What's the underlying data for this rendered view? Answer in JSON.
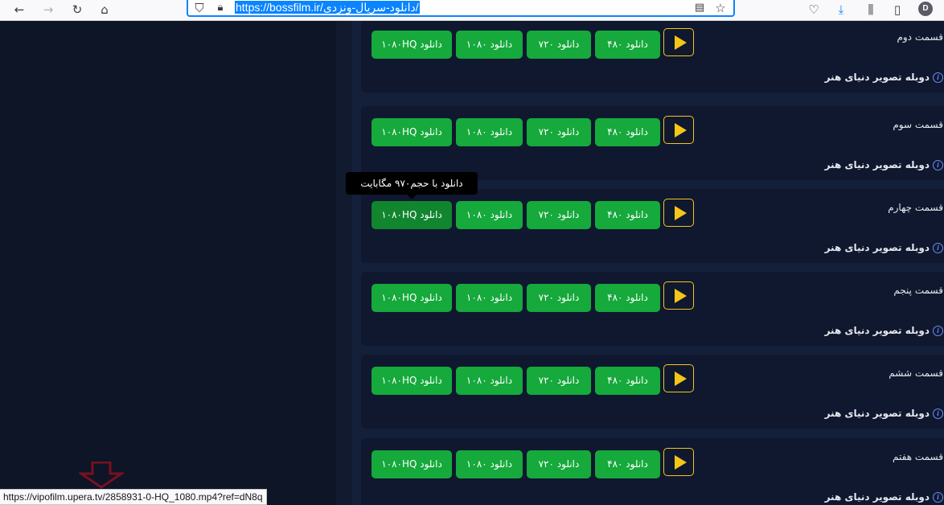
{
  "browser": {
    "url": "https://bossfilm.ir/دانلود-سریال-ونزدی/",
    "profile_initial": "D",
    "icons": [
      "back-icon",
      "forward-icon",
      "reload-icon",
      "home-icon",
      "shield-icon",
      "lock-icon",
      "reader-view-icon",
      "bookmark-star-icon",
      "pocket-icon",
      "download-icon",
      "library-icon",
      "sidebar-icon"
    ]
  },
  "episodes": [
    {
      "title": "قسمت دوم",
      "dub": "دوبله تصویر دنیای هنر",
      "b480": "دانلود ۴۸۰",
      "b720": "دانلود ۷۲۰",
      "b1080": "دانلود ۱۰۸۰",
      "bhq": "دانلود ۱۰۸۰HQ"
    },
    {
      "title": "قسمت سوم",
      "dub": "دوبله تصویر دنیای هنر",
      "b480": "دانلود ۴۸۰",
      "b720": "دانلود ۷۲۰",
      "b1080": "دانلود ۱۰۸۰",
      "bhq": "دانلود ۱۰۸۰HQ"
    },
    {
      "title": "قسمت چهارم",
      "dub": "دوبله تصویر دنیای هنر",
      "b480": "دانلود ۴۸۰",
      "b720": "دانلود ۷۲۰",
      "b1080": "دانلود ۱۰۸۰",
      "bhq": "دانلود ۱۰۸۰HQ"
    },
    {
      "title": "قسمت پنجم",
      "dub": "دوبله تصویر دنیای هنر",
      "b480": "دانلود ۴۸۰",
      "b720": "دانلود ۷۲۰",
      "b1080": "دانلود ۱۰۸۰",
      "bhq": "دانلود ۱۰۸۰HQ"
    },
    {
      "title": "قسمت ششم",
      "dub": "دوبله تصویر دنیای هنر",
      "b480": "دانلود ۴۸۰",
      "b720": "دانلود ۷۲۰",
      "b1080": "دانلود ۱۰۸۰",
      "bhq": "دانلود ۱۰۸۰HQ"
    },
    {
      "title": "قسمت هفتم",
      "dub": "دوبله تصویر دنیای هنر",
      "b480": "دانلود ۴۸۰",
      "b720": "دانلود ۷۲۰",
      "b1080": "دانلود ۱۰۸۰",
      "bhq": "دانلود ۱۰۸۰HQ"
    }
  ],
  "tooltip": "دانلود با حجم۹۷۰ مگابایت",
  "status_url": "https://vipofilm.upera.tv/2858931-0-HQ_1080.mp4?ref=dN8q",
  "colors": {
    "download_button": "#16a93c",
    "download_button_hover": "#12852f",
    "play_accent": "#f5c518",
    "info_icon": "#6c8cff",
    "annotation_arrow": "#7a1020",
    "page_background": "#14203a"
  }
}
